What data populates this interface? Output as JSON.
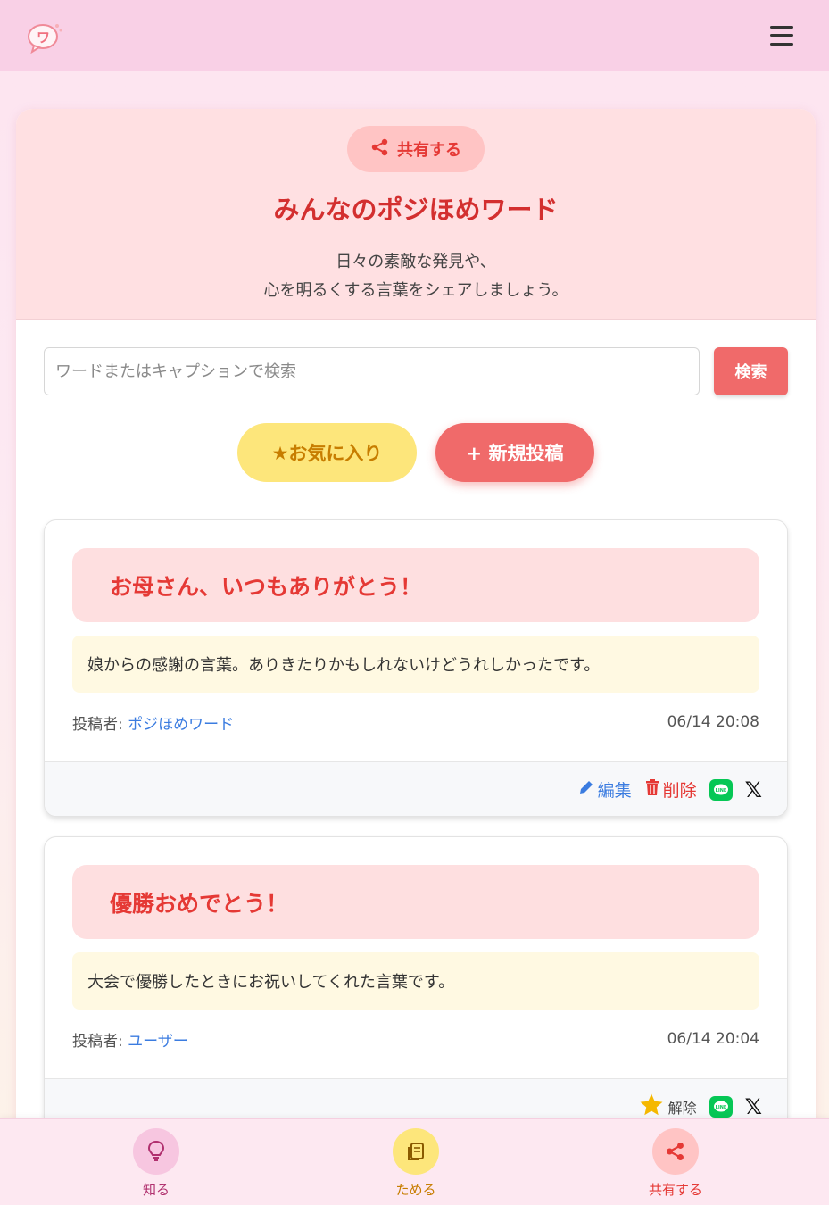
{
  "header": {
    "logo_icon": "speech-bubble-logo-icon",
    "menu_icon": "hamburger-menu-icon"
  },
  "hero": {
    "share_label": "共有する",
    "title": "みんなのポジほめワード",
    "desc_line1": "日々の素敵な発見や、",
    "desc_line2": "心を明るくする言葉をシェアしましょう。"
  },
  "search": {
    "placeholder": "ワードまたはキャプションで検索",
    "value": "",
    "button_label": "検索"
  },
  "actions": {
    "favorites_label": "★お気に入り",
    "new_post_label": "+ 新規投稿"
  },
  "posts": [
    {
      "title": "お母さん、いつもありがとう！",
      "caption": "娘からの感謝の言葉。ありきたりかもしれないけどうれしかったです。",
      "author_prefix": "投稿者: ",
      "author": "ポジほめワード",
      "date": "06/14 20:08",
      "edit_label": "編集",
      "delete_label": "削除",
      "line_label": "LINE",
      "x_label": "𝕏"
    },
    {
      "title": "優勝おめでとう！",
      "caption": "大会で優勝したときにお祝いしてくれた言葉です。",
      "author_prefix": "投稿者: ",
      "author": "ユーザー",
      "date": "06/14 20:04",
      "unfav_label": "解除",
      "line_label": "LINE",
      "x_label": "𝕏"
    }
  ],
  "bottom_nav": [
    {
      "label": "知る",
      "icon": "lightbulb-icon",
      "color": "#f7c6e0",
      "text_color": "#b0306e"
    },
    {
      "label": "ためる",
      "icon": "notebook-icon",
      "color": "#fde67b",
      "text_color": "#c77d00"
    },
    {
      "label": "共有する",
      "icon": "share-icon",
      "color": "#ffc4c4",
      "text_color": "#e53935"
    }
  ],
  "colors": {
    "accent": "#f06a6a",
    "title_red": "#d32f2f",
    "link_blue": "#3b7ce0",
    "line_green": "#06c755"
  }
}
